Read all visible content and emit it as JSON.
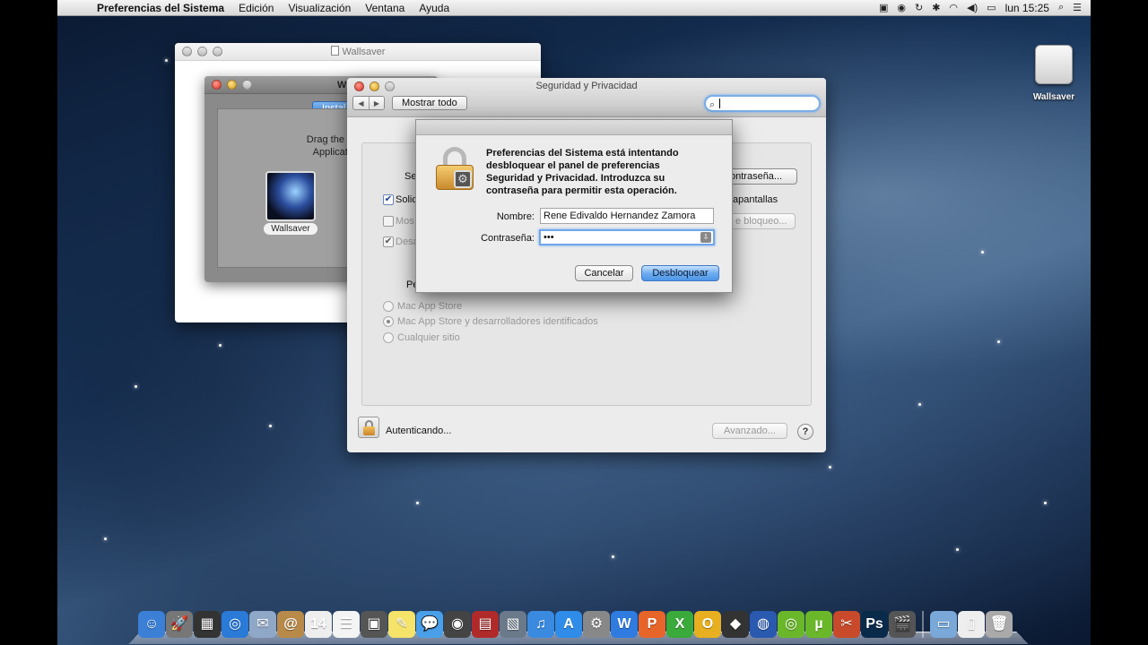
{
  "menubar": {
    "app_name": "Preferencias del Sistema",
    "menus": [
      "Edición",
      "Visualización",
      "Ventana",
      "Ayuda"
    ],
    "clock": "lun 15:25"
  },
  "desktop": {
    "drive_label": "Wallsaver"
  },
  "wallsaver_window": {
    "title": "Wallsaver"
  },
  "installer_window": {
    "title_fragment": "W",
    "tab_label": "Instal",
    "drag_text_line1": "Drag the Wall",
    "drag_text_line2": "Applications",
    "app_label": "Wallsaver"
  },
  "security_window": {
    "title": "Seguridad y Privacidad",
    "show_all": "Mostrar todo",
    "search_value": "",
    "partial_label_se": "Se",
    "change_password_fragment": "ontraseña...",
    "chk_solicitar": "Solic",
    "chk_solicitar_suffix": "apantallas",
    "chk_mostrar": "Mos",
    "lock_button_fragment": "e bloqueo...",
    "chk_desactivar": "Desa",
    "partial_label_pe": "Pe",
    "radio_options": [
      "Mac App Store",
      "Mac App Store y desarrolladores identificados",
      "Cualquier sitio"
    ],
    "status": "Autenticando...",
    "advanced": "Avanzado...",
    "help": "?"
  },
  "auth_sheet": {
    "message": "Preferencias del Sistema está intentando desbloquear el panel de preferencias Seguridad y Privacidad. Introduzca su contraseña para permitir esta operación.",
    "name_label": "Nombre:",
    "name_value": "Rene Edivaldo Hernandez Zamora",
    "password_label": "Contraseña:",
    "password_value": "•••",
    "cancel": "Cancelar",
    "unlock": "Desbloquear"
  },
  "dock": {
    "items": [
      {
        "icon": "finder-icon",
        "glyph": "☺",
        "color": "#3b7fd6"
      },
      {
        "icon": "launchpad-icon",
        "glyph": "🚀",
        "color": "#777"
      },
      {
        "icon": "mission-control-icon",
        "glyph": "▦",
        "color": "#333"
      },
      {
        "icon": "safari-icon",
        "glyph": "◎",
        "color": "#2a7ad8"
      },
      {
        "icon": "mail-icon",
        "glyph": "✉",
        "color": "#8fa8c8"
      },
      {
        "icon": "contacts-icon",
        "glyph": "@",
        "color": "#b88a4a"
      },
      {
        "icon": "calendar-icon",
        "glyph": "14",
        "color": "#eee"
      },
      {
        "icon": "reminders-icon",
        "glyph": "☰",
        "color": "#f4f4f4"
      },
      {
        "icon": "photobooth-icon",
        "glyph": "▣",
        "color": "#555"
      },
      {
        "icon": "stickies-icon",
        "glyph": "✎",
        "color": "#f5e36a"
      },
      {
        "icon": "messages-icon",
        "glyph": "💬",
        "color": "#4aa0e8"
      },
      {
        "icon": "facetime-icon",
        "glyph": "◉",
        "color": "#444"
      },
      {
        "icon": "photo-icon",
        "glyph": "▤",
        "color": "#b02a2a"
      },
      {
        "icon": "iphoto-icon",
        "glyph": "▧",
        "color": "#6a7a8a"
      },
      {
        "icon": "itunes-icon",
        "glyph": "♫",
        "color": "#3a8ae0"
      },
      {
        "icon": "appstore-icon",
        "glyph": "A",
        "color": "#2f8ce8"
      },
      {
        "icon": "system-preferences-icon",
        "glyph": "⚙",
        "color": "#888"
      },
      {
        "icon": "word-icon",
        "glyph": "W",
        "color": "#2f7be0"
      },
      {
        "icon": "powerpoint-icon",
        "glyph": "P",
        "color": "#e8652a"
      },
      {
        "icon": "excel-icon",
        "glyph": "X",
        "color": "#3aaa3a"
      },
      {
        "icon": "outlook-icon",
        "glyph": "O",
        "color": "#e8b020"
      },
      {
        "icon": "theme-icon",
        "glyph": "◆",
        "color": "#333"
      },
      {
        "icon": "globe-icon",
        "glyph": "◍",
        "color": "#2a5ab0"
      },
      {
        "icon": "spotify-icon",
        "glyph": "◎",
        "color": "#6ab82a"
      },
      {
        "icon": "utorrent-icon",
        "glyph": "µ",
        "color": "#6ab82a"
      },
      {
        "icon": "tools-icon",
        "glyph": "✂",
        "color": "#c84a2a"
      },
      {
        "icon": "photoshop-icon",
        "glyph": "Ps",
        "color": "#0a2a4a"
      },
      {
        "icon": "clapper-icon",
        "glyph": "🎬",
        "color": "#555"
      }
    ],
    "right_items": [
      {
        "icon": "applications-folder-icon",
        "glyph": "▭",
        "color": "#7aa8d8"
      },
      {
        "icon": "documents-icon",
        "glyph": "▯",
        "color": "#eee"
      },
      {
        "icon": "trash-icon",
        "glyph": "🗑",
        "color": "#aaa"
      }
    ]
  }
}
